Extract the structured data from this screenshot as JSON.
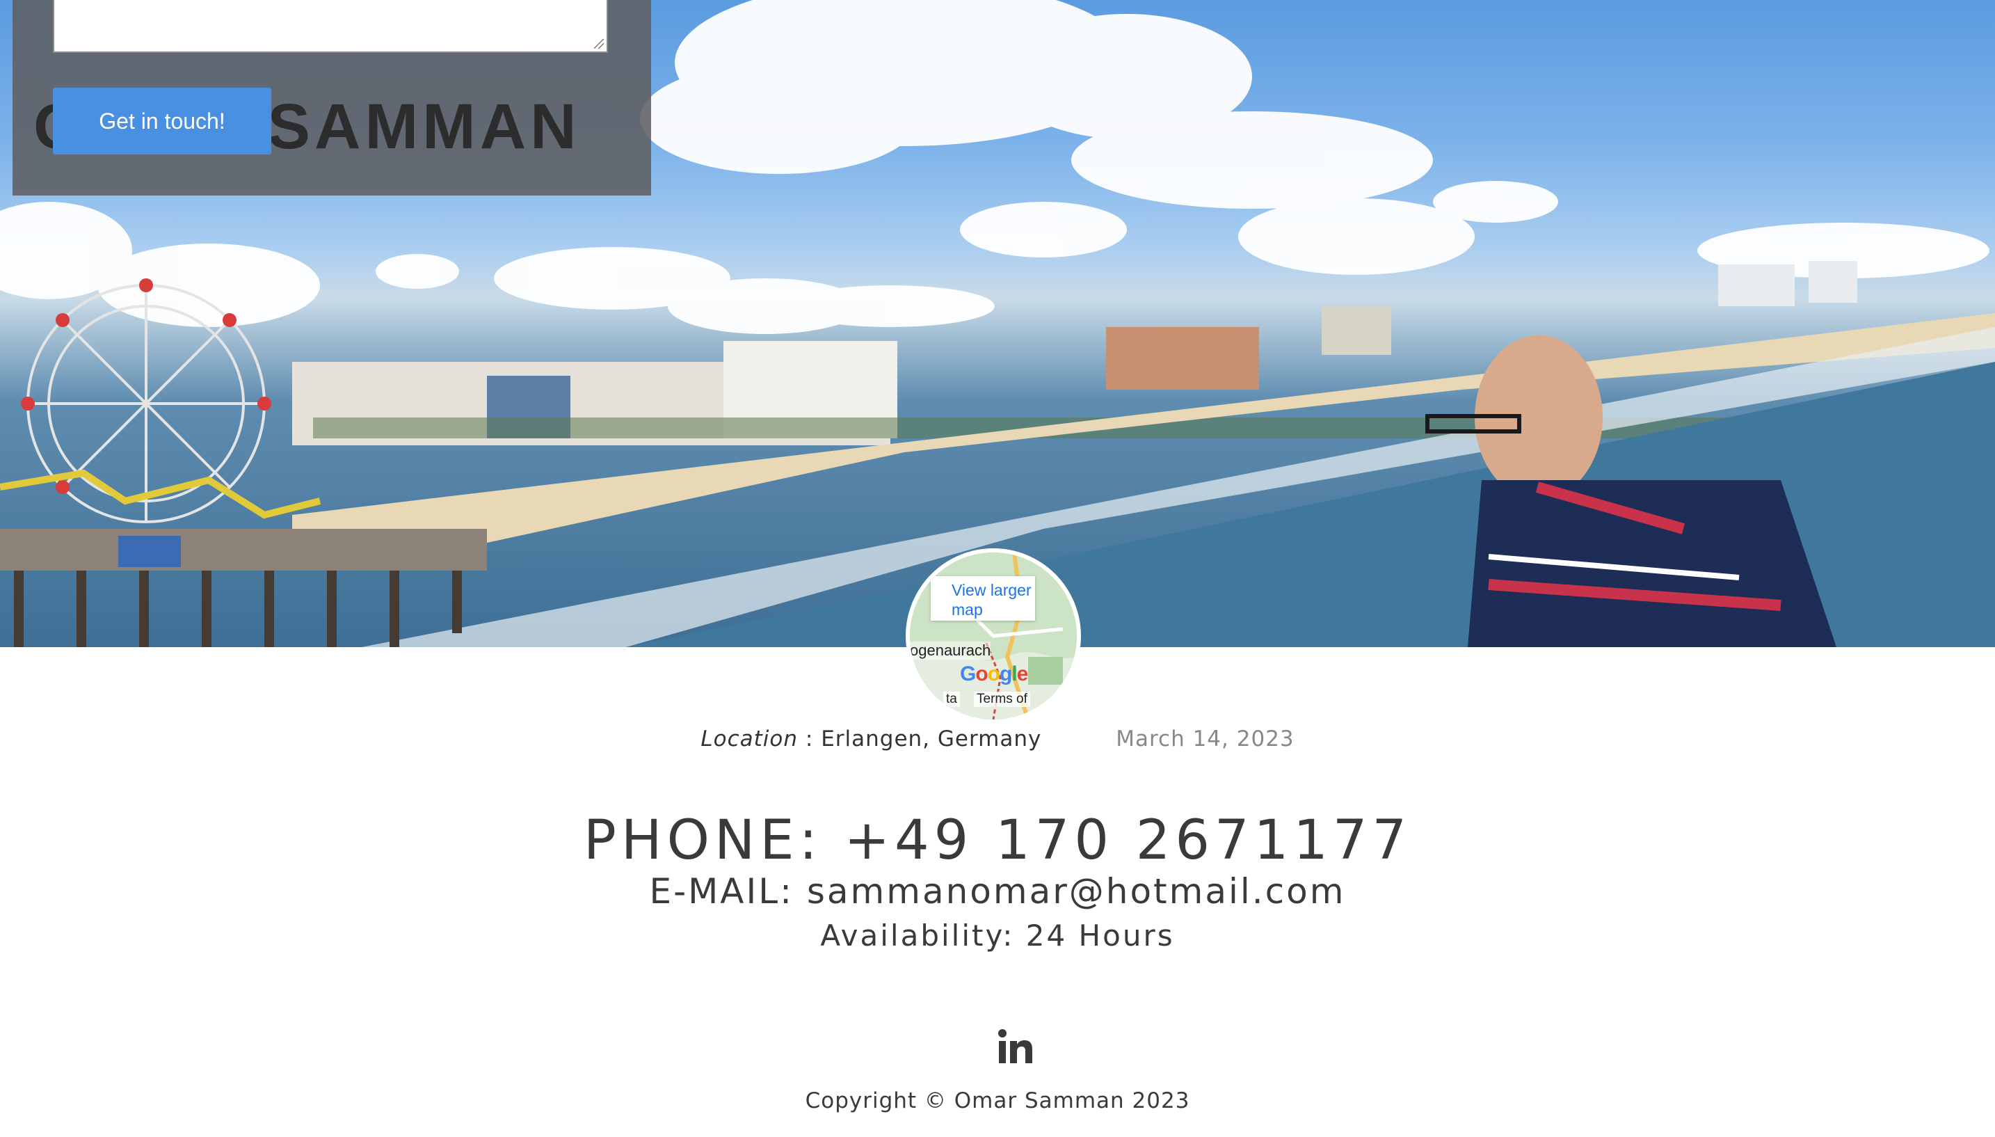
{
  "hero": {
    "title": "OMAR SAMMAN",
    "cta_label": "Get in touch!"
  },
  "map": {
    "link_label": "View larger map",
    "town": "ogenaurach",
    "google_label": "Google",
    "terms_label": "Terms of",
    "data_label": "ta"
  },
  "meta": {
    "location_label": "Location",
    "location_separator": " : ",
    "location_value": "Erlangen, Germany",
    "date": "March 14, 2023"
  },
  "contact": {
    "phone": "PHONE: +49 170 2671177",
    "email": "E-MAIL: sammanomar@hotmail.com",
    "availability": "Availability: 24 Hours"
  },
  "footer": {
    "social_icon": "linkedin-icon",
    "copyright": "Copyright © Omar Samman 2023"
  },
  "colors": {
    "button": "#4a90e2",
    "text": "#3a3a3a",
    "date": "#888888",
    "overlay": "#5f5f62"
  }
}
